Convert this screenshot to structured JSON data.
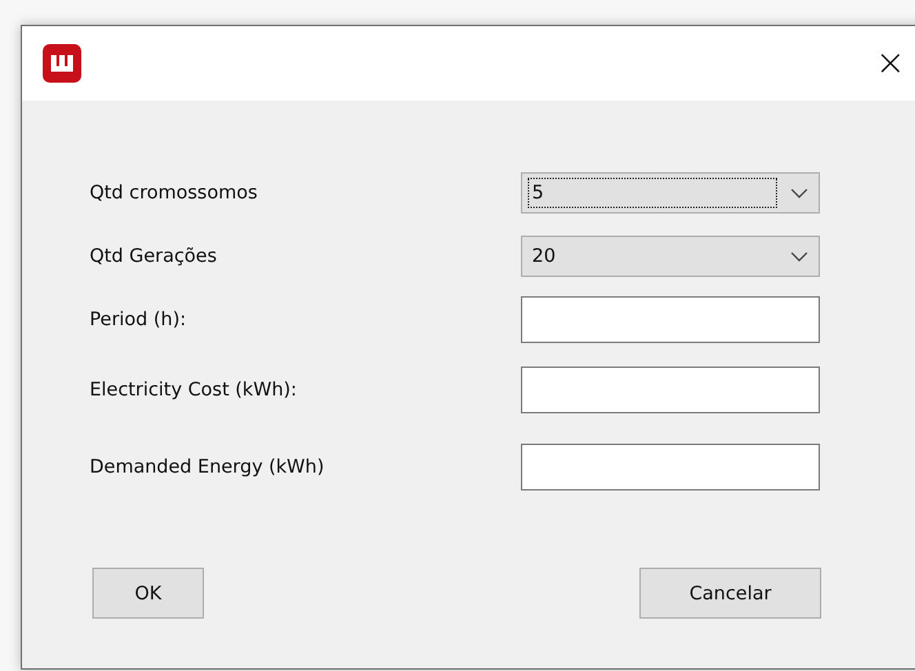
{
  "window": {
    "close_glyph": "×"
  },
  "rows": [
    {
      "kind": "dropdown",
      "label": "Qtd cromossomos",
      "value": "5",
      "focused": true
    },
    {
      "kind": "dropdown",
      "label": "Qtd Gerações",
      "value": "20",
      "focused": false
    },
    {
      "kind": "text",
      "label": "Period (h):",
      "value": ""
    },
    {
      "kind": "text",
      "label": "Electricity Cost (kWh):",
      "value": ""
    },
    {
      "kind": "text",
      "label": "Demanded Energy (kWh)",
      "value": ""
    }
  ],
  "buttons": [
    "OK",
    "Cancelar"
  ]
}
